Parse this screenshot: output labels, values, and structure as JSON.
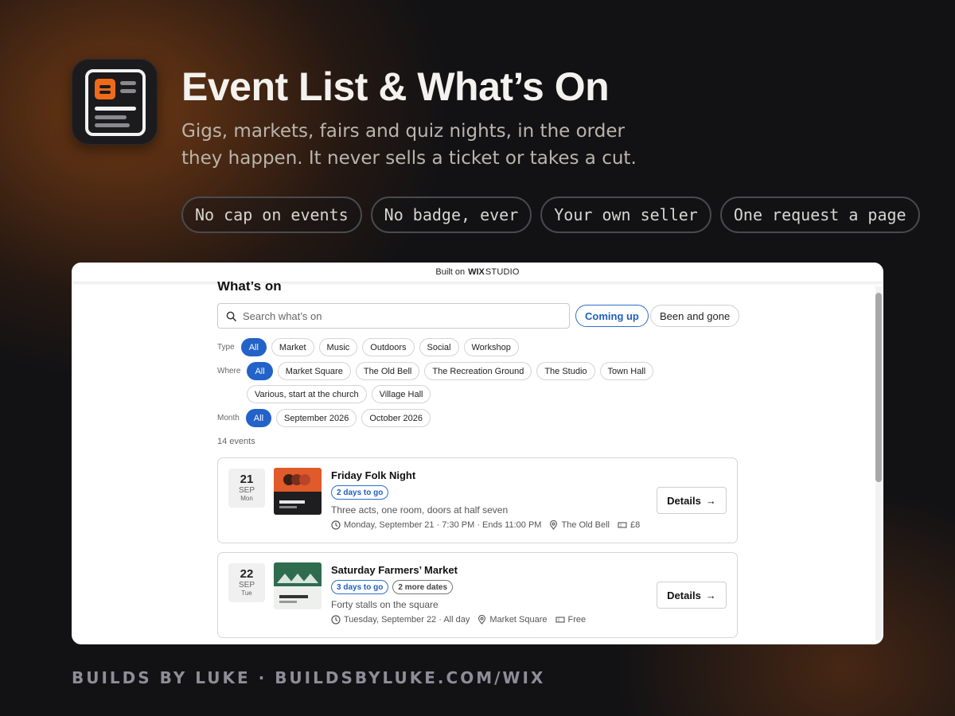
{
  "header": {
    "title": "Event List & What’s On",
    "subtitle_line1": "Gigs, markets, fairs and quiz nights, in the order",
    "subtitle_line2": "they happen. It never sells a ticket or takes a cut.",
    "pills": [
      "No cap on events",
      "No badge, ever",
      "Your own seller",
      "One request a page"
    ]
  },
  "footer": {
    "text": "BUILDS BY LUKE · BUILDSBYLUKE.COM/WIX"
  },
  "builtbar": {
    "prefix": "Built on",
    "brand": "WIX",
    "brand2": "STUDIO"
  },
  "page": {
    "heading": "What’s on",
    "search_placeholder": "Search what’s on",
    "toggle_active": "Coming up",
    "toggle_other": "Been and gone",
    "type_label": "Type",
    "type_chips": [
      "All",
      "Market",
      "Music",
      "Outdoors",
      "Social",
      "Workshop"
    ],
    "where_label": "Where",
    "where_chips_row1": [
      "All",
      "Market Square",
      "The Old Bell",
      "The Recreation Ground",
      "The Studio",
      "Town Hall"
    ],
    "where_chips_row2": [
      "Various, start at the church",
      "Village Hall"
    ],
    "month_label": "Month",
    "month_chips": [
      "All",
      "September 2026",
      "October 2026"
    ],
    "count": "14 events"
  },
  "events": [
    {
      "day": "21",
      "month": "SEP",
      "weekday": "Mon",
      "title": "Friday Folk Night",
      "tags": [
        "2 days to go"
      ],
      "description": "Three acts, one room, doors at half seven",
      "when": "Monday, September 21 · 7:30 PM · Ends 11:00 PM",
      "venue": "The Old Bell",
      "price": "£8",
      "details_label": "Details"
    },
    {
      "day": "22",
      "month": "SEP",
      "weekday": "Tue",
      "title": "Saturday Farmers’ Market",
      "tags": [
        "3 days to go",
        "2 more dates"
      ],
      "description": "Forty stalls on the square",
      "when": "Tuesday, September 22 · All day",
      "venue": "Market Square",
      "price": "Free",
      "details_label": "Details"
    }
  ],
  "colors": {
    "accent": "#2262c9",
    "brand_orange": "#f06a1a",
    "folk_thumb": "#e05a2a",
    "market_thumb": "#2f6b4f"
  }
}
